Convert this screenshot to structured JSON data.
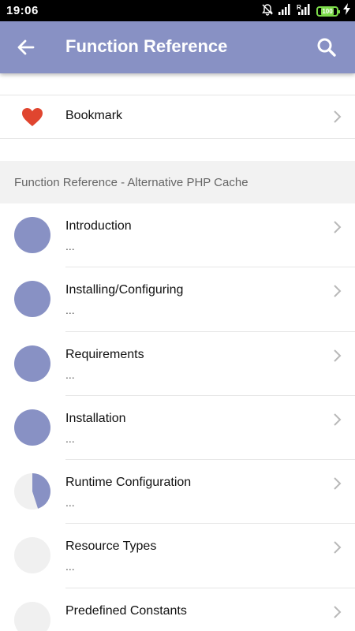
{
  "status_bar": {
    "time": "19:06",
    "battery": "100",
    "icons": [
      "bell-off-icon",
      "signal-icon",
      "signal-roaming-icon",
      "battery-icon",
      "charging-icon"
    ]
  },
  "app_bar": {
    "title": "Function Reference",
    "icons": [
      "arrow-left-icon",
      "search-icon"
    ],
    "color": "#8891c4"
  },
  "bookmark": {
    "label": "Bookmark",
    "icon": "heart-icon",
    "color": "#e0452f"
  },
  "section": {
    "title": "Function Reference - Alternative PHP Cache"
  },
  "items": [
    {
      "title": "Introduction",
      "subtitle": "...",
      "progress": 1.0
    },
    {
      "title": "Installing/Configuring",
      "subtitle": "...",
      "progress": 1.0
    },
    {
      "title": "Requirements",
      "subtitle": "...",
      "progress": 1.0
    },
    {
      "title": "Installation",
      "subtitle": "...",
      "progress": 1.0
    },
    {
      "title": "Runtime Configuration",
      "subtitle": "...",
      "progress": 0.45
    },
    {
      "title": "Resource Types",
      "subtitle": "...",
      "progress": 0
    },
    {
      "title": "Predefined Constants",
      "subtitle": "...",
      "progress": 0
    }
  ],
  "colors": {
    "progress_fill": "#8891c4",
    "progress_track": "#f0f0f0"
  }
}
